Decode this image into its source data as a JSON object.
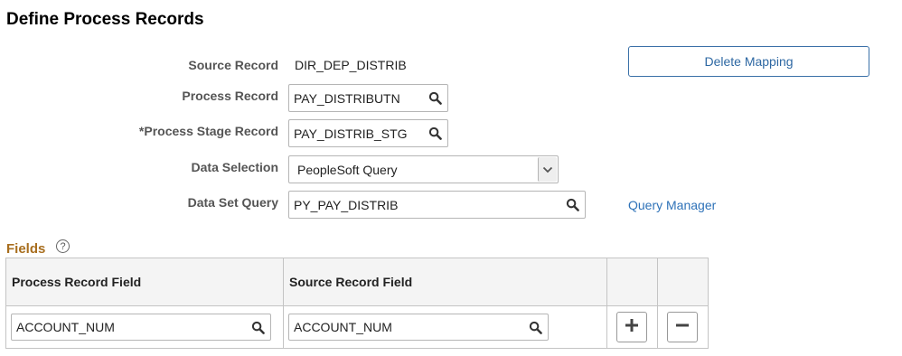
{
  "page": {
    "title": "Define Process Records"
  },
  "form": {
    "source_record": {
      "label": "Source Record",
      "value": "DIR_DEP_DISTRIB"
    },
    "process_record": {
      "label": "Process Record",
      "value": "PAY_DISTRIBUTN"
    },
    "process_stage_record": {
      "label": "*Process Stage Record",
      "value": "PAY_DISTRIB_STG"
    },
    "data_selection": {
      "label": "Data Selection",
      "value": "PeopleSoft Query"
    },
    "data_set_query": {
      "label": "Data Set Query",
      "value": "PY_PAY_DISTRIB"
    }
  },
  "actions": {
    "delete_mapping": "Delete Mapping",
    "query_manager": "Query Manager"
  },
  "fields_section": {
    "title": "Fields",
    "help": "?",
    "columns": [
      "Process Record Field",
      "Source Record Field"
    ],
    "rows": [
      {
        "process_field": "ACCOUNT_NUM",
        "source_field": "ACCOUNT_NUM"
      }
    ]
  },
  "icons": {
    "search": "search-icon",
    "dropdown": "chevron-down-icon",
    "add": "plus-icon",
    "remove": "minus-icon"
  }
}
